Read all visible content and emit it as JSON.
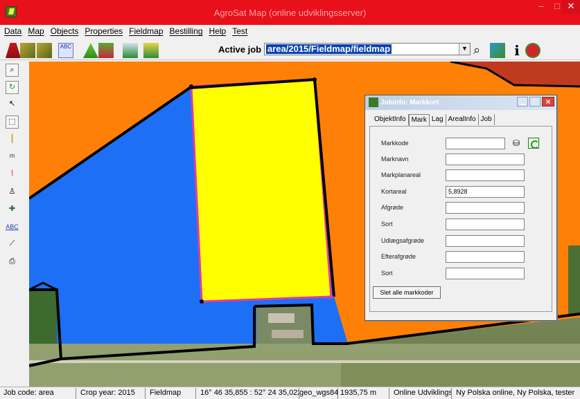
{
  "window": {
    "title": "AgroSat Map (online udviklingsserver)",
    "minimize": "‒",
    "maximize": "□",
    "close": "✕"
  },
  "menu": [
    "Data",
    "Map",
    "Objects",
    "Properties",
    "Fieldmap",
    "Bestilling",
    "Help",
    "Test"
  ],
  "toolbar": {
    "active_job_label": "Active job",
    "active_job_value": "area/2015/Fieldmap/fieldmap",
    "abc_icon": "ABC"
  },
  "toolbox": {
    "ruler_label": "m",
    "abc_label": "ABC"
  },
  "map": {
    "colors": {
      "orange": "#fe8006",
      "blue": "#1d6ff6",
      "yellow": "#ffff00",
      "brown": "#c03a1f",
      "green": "#2f6a27",
      "outline": "#e33aa5"
    }
  },
  "dialog": {
    "title": "Jobinfo: Markkort",
    "tabs": [
      "ObjektInfo",
      "Mark",
      "Lag",
      "ArealInfo",
      "Job"
    ],
    "active_tab": "Mark",
    "fields": [
      {
        "label": "Markkode",
        "value": ""
      },
      {
        "label": "Marknavn",
        "value": ""
      },
      {
        "label": "Markplanareal",
        "value": ""
      },
      {
        "label": "Kortareal",
        "value": "5,8928"
      },
      {
        "label": "Afgrøde",
        "value": ""
      },
      {
        "label": "Sort",
        "value": ""
      },
      {
        "label": "Udlægsafgrøde",
        "value": ""
      },
      {
        "label": "Efterafgrøde",
        "value": ""
      },
      {
        "label": "Sort",
        "value": ""
      }
    ],
    "delete_button": "Slet alle markkoder"
  },
  "status": {
    "job_code": "Job code: area",
    "crop_year": "Crop year: 2015",
    "mode": "Fieldmap",
    "coords": "16° 46 35,855 : 52° 24 35,022",
    "projection": "geo_wgs84",
    "distance": "1935,75 m",
    "server": "Online Udviklingsserver",
    "user": "Ny Polska online, Ny Polska, tester"
  }
}
